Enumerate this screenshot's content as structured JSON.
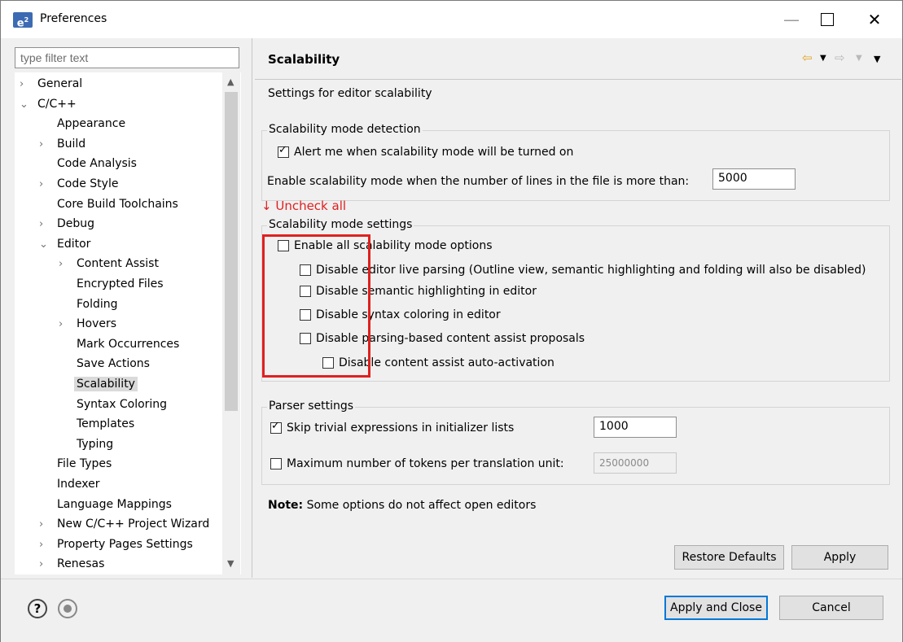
{
  "window": {
    "title": "Preferences",
    "icon": "e²"
  },
  "sidebar": {
    "filter_placeholder": "type filter text",
    "items": [
      {
        "label": "General",
        "arrow": "›",
        "indent": 0
      },
      {
        "label": "C/C++",
        "arrow": "⌄",
        "indent": 0
      },
      {
        "label": "Appearance",
        "arrow": "",
        "indent": 1
      },
      {
        "label": "Build",
        "arrow": "›",
        "indent": 1
      },
      {
        "label": "Code Analysis",
        "arrow": "",
        "indent": 1
      },
      {
        "label": "Code Style",
        "arrow": "›",
        "indent": 1
      },
      {
        "label": "Core Build Toolchains",
        "arrow": "",
        "indent": 1
      },
      {
        "label": "Debug",
        "arrow": "›",
        "indent": 1
      },
      {
        "label": "Editor",
        "arrow": "⌄",
        "indent": 1
      },
      {
        "label": "Content Assist",
        "arrow": "›",
        "indent": 2
      },
      {
        "label": "Encrypted Files",
        "arrow": "",
        "indent": 2
      },
      {
        "label": "Folding",
        "arrow": "",
        "indent": 2
      },
      {
        "label": "Hovers",
        "arrow": "›",
        "indent": 2
      },
      {
        "label": "Mark Occurrences",
        "arrow": "",
        "indent": 2
      },
      {
        "label": "Save Actions",
        "arrow": "",
        "indent": 2
      },
      {
        "label": "Scalability",
        "arrow": "",
        "indent": 2,
        "selected": true
      },
      {
        "label": "Syntax Coloring",
        "arrow": "",
        "indent": 2
      },
      {
        "label": "Templates",
        "arrow": "",
        "indent": 2
      },
      {
        "label": "Typing",
        "arrow": "",
        "indent": 2
      },
      {
        "label": "File Types",
        "arrow": "",
        "indent": 1
      },
      {
        "label": "Indexer",
        "arrow": "",
        "indent": 1
      },
      {
        "label": "Language Mappings",
        "arrow": "",
        "indent": 1
      },
      {
        "label": "New C/C++ Project Wizard",
        "arrow": "›",
        "indent": 1
      },
      {
        "label": "Property Pages Settings",
        "arrow": "›",
        "indent": 1
      },
      {
        "label": "Renesas",
        "arrow": "›",
        "indent": 1
      }
    ]
  },
  "page": {
    "title": "Scalability",
    "description": "Settings for editor scalability",
    "detection": {
      "title": "Scalability mode detection",
      "alert_label": "Alert me when scalability mode will be turned on",
      "alert_checked": true,
      "lines_label": "Enable scalability mode when the number of lines in the file is more than:",
      "lines_value": "5000"
    },
    "annotation": "↓ Uncheck all",
    "settings": {
      "title": "Scalability mode settings",
      "options": [
        {
          "label": "Enable all scalability mode options",
          "checked": false
        },
        {
          "label": "Disable editor live parsing (Outline view, semantic highlighting and folding will also be disabled)",
          "checked": false
        },
        {
          "label": "Disable semantic highlighting in editor",
          "checked": false
        },
        {
          "label": "Disable syntax coloring in editor",
          "checked": false
        },
        {
          "label": "Disable parsing-based content assist proposals",
          "checked": false
        },
        {
          "label": "Disable content assist auto-activation",
          "checked": false
        }
      ]
    },
    "parser": {
      "title": "Parser settings",
      "skip_label": "Skip trivial expressions in initializer lists",
      "skip_checked": true,
      "skip_value": "1000",
      "max_label": "Maximum number of tokens per translation unit:",
      "max_checked": false,
      "max_value": "25000000"
    },
    "note_bold": "Note:",
    "note_text": "Some options do not affect open editors",
    "restore_defaults": "Restore Defaults",
    "apply": "Apply"
  },
  "footer": {
    "apply_and_close": "Apply and Close",
    "cancel": "Cancel"
  }
}
